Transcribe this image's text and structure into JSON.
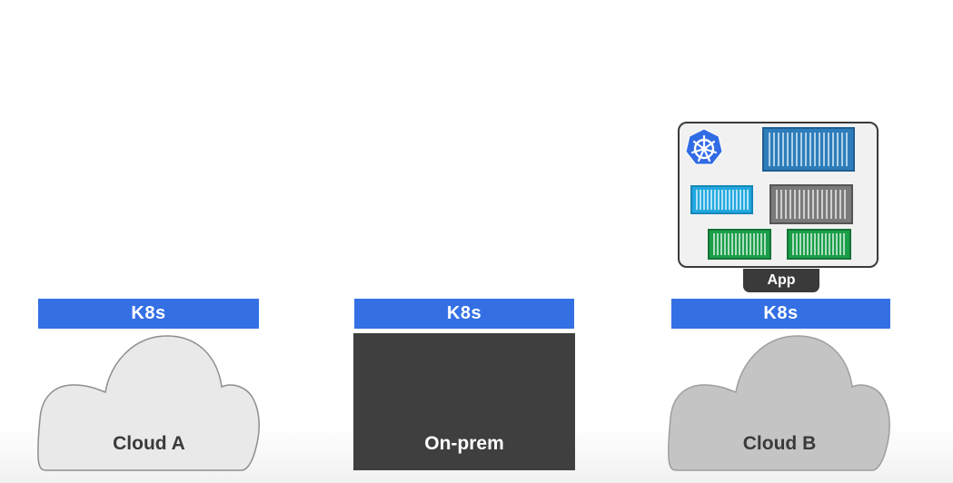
{
  "clusters": {
    "cloud_a": {
      "k8s_label": "K8s",
      "name": "Cloud A"
    },
    "on_prem": {
      "k8s_label": "K8s",
      "name": "On-prem"
    },
    "cloud_b": {
      "k8s_label": "K8s",
      "name": "Cloud B"
    }
  },
  "app": {
    "label": "App",
    "containers": [
      {
        "color": "#2e7dba",
        "size": "large"
      },
      {
        "color": "#22a8e0",
        "size": "small"
      },
      {
        "color": "#7a7a7a",
        "size": "medium"
      },
      {
        "color": "#1b9e4a",
        "size": "small"
      },
      {
        "color": "#1b9e4a",
        "size": "small"
      }
    ]
  },
  "colors": {
    "k8s_bar": "#3470e4",
    "cloud_a_fill": "#e9e9e9",
    "cloud_b_fill": "#c4c4c4",
    "on_prem_fill": "#3f3f3f",
    "kubernetes_logo": "#326ce5"
  },
  "icons": [
    "kubernetes-icon"
  ]
}
